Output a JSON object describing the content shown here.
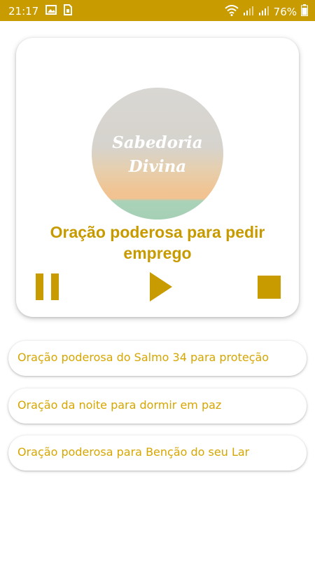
{
  "status_bar": {
    "time": "21:17",
    "battery": "76%",
    "icons": [
      "image-icon",
      "sim-icon",
      "wifi-icon",
      "signal-icon",
      "signal-icon",
      "battery-icon"
    ]
  },
  "player": {
    "cover_title_line1": "Sabedoria",
    "cover_title_line2": "Divina",
    "track_title": "Oração poderosa para pedir emprego",
    "controls": [
      "pause-icon",
      "play-icon",
      "stop-icon"
    ]
  },
  "tracks": [
    {
      "label": "Oração poderosa do Salmo 34 para proteção"
    },
    {
      "label": "Oração da noite para dormir em paz"
    },
    {
      "label": "Oração poderosa para Benção do seu Lar"
    }
  ],
  "colors": {
    "accent": "#c89c00",
    "title": "#c79a00",
    "list_text": "#d6a600",
    "background": "#ffffff"
  }
}
